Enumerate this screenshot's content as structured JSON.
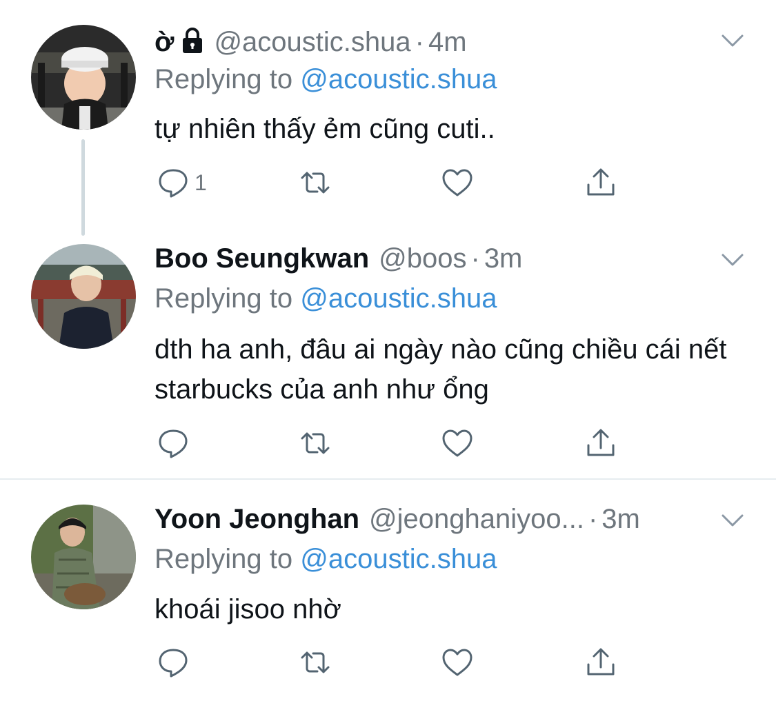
{
  "tweets": [
    {
      "name": "ờ",
      "locked": true,
      "handle": "@acoustic.shua",
      "dot": "·",
      "time": "4m",
      "replying_prefix": "Replying to",
      "replying_to": "@acoustic.shua",
      "text": "tự nhiên thấy ẻm cũng cuti..",
      "reply_count": "1"
    },
    {
      "name": "Boo Seungkwan",
      "handle": "@boos",
      "dot": "·",
      "time": "3m",
      "replying_prefix": "Replying to",
      "replying_to": "@acoustic.shua",
      "text": "dth ha anh, đâu ai ngày nào cũng chiều cái nết starbucks của anh như ổng",
      "reply_count": ""
    },
    {
      "name": "Yoon Jeonghan",
      "handle": "@jeonghaniyoo...",
      "dot": "·",
      "time": "3m",
      "replying_prefix": "Replying to",
      "replying_to": "@acoustic.shua",
      "text": "khoái jisoo nhờ",
      "reply_count": ""
    }
  ],
  "icons": [
    "reply-icon",
    "retweet-icon",
    "like-icon",
    "share-icon",
    "chevron-down-icon",
    "lock-icon"
  ],
  "colors": {
    "link": "#3a8fd8",
    "muted": "#6e767d",
    "text": "#0f1419",
    "divider": "#e6ecf0"
  }
}
